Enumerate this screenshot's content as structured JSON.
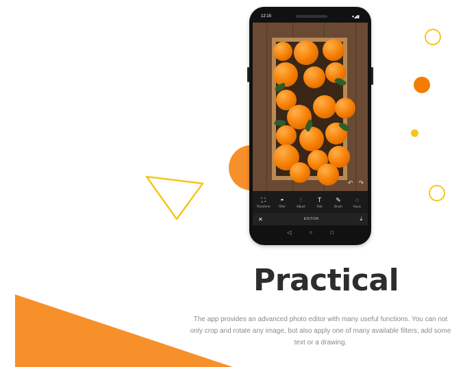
{
  "status_bar": {
    "time": "12:15",
    "signal_glyph": "▾◢▮"
  },
  "editor": {
    "tools": [
      {
        "label": "Transform",
        "icon": "crop-rotate-icon",
        "glyph": "⛶"
      },
      {
        "label": "Filter",
        "icon": "filter-icon",
        "glyph": "◓"
      },
      {
        "label": "Adjust",
        "icon": "sliders-icon",
        "glyph": "⫶"
      },
      {
        "label": "Text",
        "icon": "text-icon",
        "glyph": "T"
      },
      {
        "label": "Brush",
        "icon": "brush-icon",
        "glyph": "✎"
      },
      {
        "label": "Focus",
        "icon": "drop-icon",
        "glyph": "◌"
      }
    ],
    "title": "EDITOR",
    "close_glyph": "✕",
    "download_glyph": "⤓",
    "undo_glyph": "↶",
    "redo_glyph": "↷"
  },
  "nav": {
    "back": "◁",
    "home": "○",
    "recent": "□"
  },
  "headline": "Practical",
  "description": "The app provides an advanced photo editor with many useful functions. You can not only crop and rotate any image, but also apply one of many available filters, add some text or a drawing.",
  "colors": {
    "accent_orange": "#f7902a",
    "accent_yellow": "#f5c518",
    "headline": "#2d2d2d"
  }
}
